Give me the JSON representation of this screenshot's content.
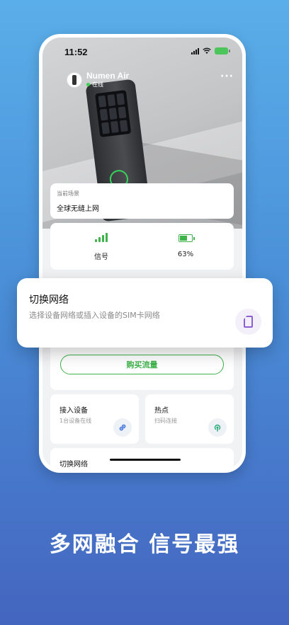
{
  "status_bar": {
    "time": "11:52"
  },
  "device": {
    "name": "Numen Air",
    "status": "在线",
    "more_label": "···"
  },
  "scene": {
    "label": "当前场景",
    "value": "全球无缝上网"
  },
  "stats": {
    "signal_label": "信号",
    "battery_label": "63%",
    "battery_level": 0.63
  },
  "buy": {
    "label": "购买流量"
  },
  "access": {
    "title": "接入设备",
    "subtitle": "1台设备在线"
  },
  "hotspot": {
    "title": "热点",
    "subtitle": "扫码连接"
  },
  "switch_network": {
    "label": "切换网络"
  },
  "popup": {
    "title": "切换网络",
    "subtitle": "选择设备网络或插入设备的SIM卡网络"
  },
  "tagline": "多网融合  信号最强",
  "colors": {
    "accent_green": "#3db34a",
    "sim_purple": "#8c5fd4",
    "background_top": "#5aaee9",
    "background_bottom": "#4465bf"
  },
  "icons": {
    "signal": "signal-bars-icon",
    "battery": "battery-icon",
    "link": "link-icon",
    "hotspot": "hotspot-icon",
    "sim": "sim-card-icon"
  }
}
